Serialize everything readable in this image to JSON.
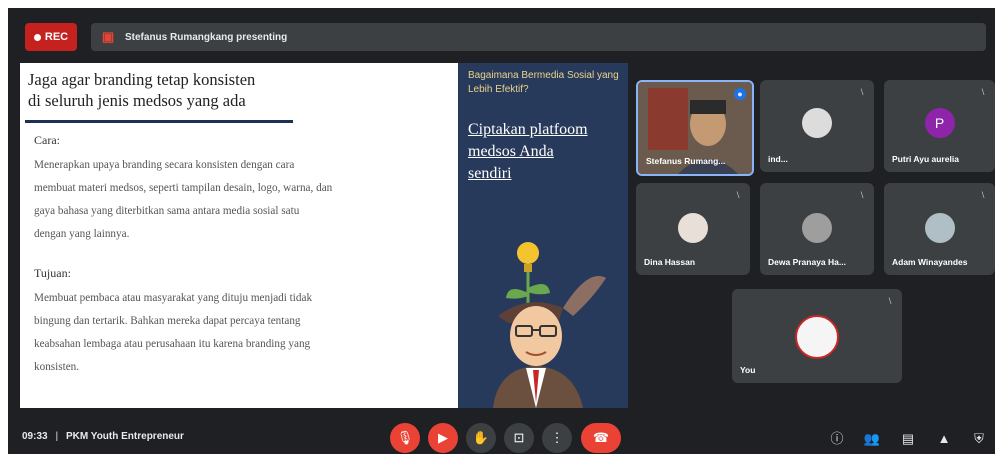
{
  "topbar": {
    "rec_label": "REC",
    "presenting_text": "Stefanus Rumangkang presenting"
  },
  "slide": {
    "title_line1": "Jaga agar branding tetap konsisten",
    "title_line2": "di seluruh jenis medsos yang ada",
    "cara_heading": "Cara:",
    "cara_lines": [
      "Menerapkan upaya branding secara konsisten dengan cara",
      "membuat materi medsos, seperti tampilan desain, logo, warna, dan",
      "gaya bahasa yang diterbitkan sama antara media sosial satu",
      "dengan yang lainnya."
    ],
    "tujuan_heading": "Tujuan:",
    "tujuan_lines": [
      "Membuat pembaca atau masyarakat yang dituju menjadi tidak",
      "bingung dan tertarik. Bahkan mereka dapat percaya tentang",
      "keabsahan lembaga atau perusahaan itu karena branding yang",
      "konsisten."
    ],
    "right_question": "Bagaimana Bermedia Sosial yang Lebih Efektif?",
    "right_heading_lines": [
      "Ciptakan platfoom",
      "medsos Anda",
      "sendiri"
    ]
  },
  "participants": [
    {
      "name": "Stefanus Rumang...",
      "speaking": true
    },
    {
      "name": "ind..."
    },
    {
      "name": "Putri Ayu aurelia",
      "initial": "P",
      "color": "#8e24aa"
    },
    {
      "name": "Dina Hassan"
    },
    {
      "name": "Dewa Pranaya Ha..."
    },
    {
      "name": "Adam Winayandes"
    },
    {
      "name": "You"
    }
  ],
  "bottombar": {
    "time": "09:33",
    "separator": "|",
    "meeting_name": "PKM Youth Entrepreneur"
  },
  "icons": {
    "mic_off": "mic-off-icon",
    "cam_off": "camera-off-icon",
    "hand": "raise-hand-icon",
    "present": "present-screen-icon",
    "more": "more-options-icon",
    "end": "end-call-icon",
    "info": "info-icon",
    "people": "people-icon",
    "chat": "chat-icon",
    "activities": "activities-icon",
    "lock": "host-controls-icon"
  },
  "colors": {
    "red": "#ea4335",
    "rec": "#c5221f",
    "tile": "#3c4043",
    "bg": "#1f2023",
    "slide_navy": "#283a5b"
  }
}
